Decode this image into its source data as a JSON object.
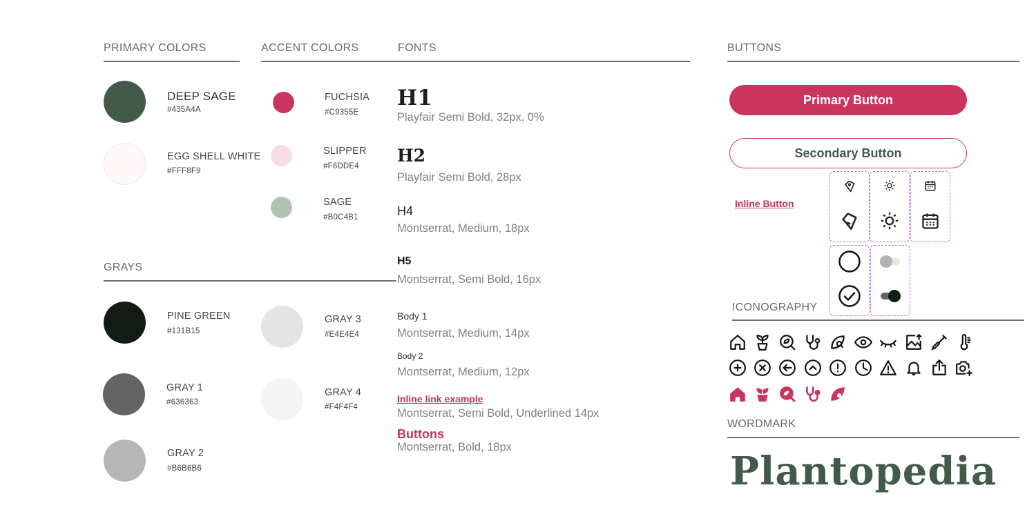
{
  "sections": {
    "primary_colors": "PRIMARY COLORS",
    "accent_colors": "ACCENT COLORS",
    "fonts": "FONTS",
    "buttons": "BUTTONS",
    "grays": "GRAYS",
    "iconography": "ICONOGRAPHY",
    "wordmark": "WORDMARK"
  },
  "primary": [
    {
      "name": "DEEP SAGE",
      "hex": "#435A4A",
      "color": "#435A4A"
    },
    {
      "name": "EGG SHELL WHITE",
      "hex": "#FFF8F9",
      "color": "#FFF8F9"
    }
  ],
  "accent": [
    {
      "name": "FUCHSIA",
      "hex": "#C9355E",
      "color": "#C9355E"
    },
    {
      "name": "SLIPPER",
      "hex": "#F6DDE4",
      "color": "#F6DDE4"
    },
    {
      "name": "SAGE",
      "hex": "#B0C4B1",
      "color": "#B0C4B1"
    }
  ],
  "grays": [
    {
      "name": "PINE GREEN",
      "hex": "#131B15",
      "color": "#131B15"
    },
    {
      "name": "GRAY 1",
      "hex": "#636363",
      "color": "#636363"
    },
    {
      "name": "GRAY 2",
      "hex": "#B6B6B6",
      "color": "#B6B6B6"
    },
    {
      "name": "GRAY 3",
      "hex": "#E4E4E4",
      "color": "#E4E4E4"
    },
    {
      "name": "GRAY 4",
      "hex": "#F4F4F4",
      "color": "#F4F4F4"
    }
  ],
  "fonts": {
    "h1": {
      "label": "H1",
      "desc": "Playfair Semi Bold, 32px, 0%"
    },
    "h2": {
      "label": "H2",
      "desc": "Playfair Semi Bold, 28px"
    },
    "h4": {
      "label": "H4",
      "desc": "Montserrat, Medium, 18px"
    },
    "h5": {
      "label": "H5",
      "desc": "Montserrat, Semi Bold, 16px"
    },
    "body1": {
      "label": "Body 1",
      "desc": "Montserrat, Medium, 14px"
    },
    "body2": {
      "label": "Body 2",
      "desc": "Montserrat, Medium, 12px"
    },
    "link": {
      "label": "Inline link example",
      "desc": "Montserrat, Semi Bold, Underlined 14px"
    },
    "buttons": {
      "label": "Buttons",
      "desc": "Montserrat, Bold, 18px"
    }
  },
  "buttons": {
    "primary": "Primary Button",
    "secondary": "Secondary Button",
    "inline": "Inline Button"
  },
  "icon_names": {
    "row1": [
      "home-icon",
      "plant-icon",
      "search-leaf-icon",
      "stethoscope-icon",
      "leaf-search-icon",
      "eye-icon",
      "eye-closed-icon",
      "image-upload-icon",
      "shovel-icon",
      "thermometer-icon"
    ],
    "row2": [
      "plus-circle-icon",
      "x-circle-icon",
      "arrow-left-circle-icon",
      "arrow-up-circle-icon",
      "alert-circle-icon",
      "clock-icon",
      "warning-icon",
      "bell-icon",
      "share-icon",
      "add-photo-icon"
    ],
    "row3": [
      "home-filled-icon",
      "plant-filled-icon",
      "search-filled-icon",
      "stethoscope-filled-icon",
      "leaf-search-filled-icon"
    ]
  },
  "accent_color": "#C9355E",
  "brand_color": "#435A4A",
  "wordmark": "Plantopedia"
}
